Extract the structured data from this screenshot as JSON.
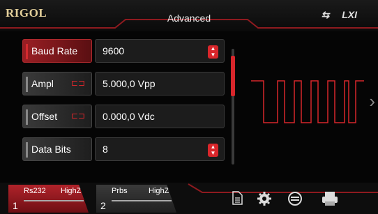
{
  "header": {
    "logo": "RIGOL",
    "title": "Advanced",
    "status_icons": [
      "usb-icon",
      "lxi-icon"
    ],
    "lxi_label": "LXI"
  },
  "params": [
    {
      "label": "Baud Rate",
      "value": "9600",
      "active": true,
      "linked": false,
      "spinner": true
    },
    {
      "label": "Ampl",
      "value": "5.000,0 Vpp",
      "active": false,
      "linked": true,
      "spinner": false
    },
    {
      "label": "Offset",
      "value": "0.000,0 Vdc",
      "active": false,
      "linked": true,
      "spinner": false
    },
    {
      "label": "Data Bits",
      "value": "8",
      "active": false,
      "linked": false,
      "spinner": true
    }
  ],
  "channels": [
    {
      "number": "1",
      "mode": "Rs232",
      "load": "HighZ"
    },
    {
      "number": "2",
      "mode": "Prbs",
      "load": "HighZ"
    }
  ],
  "toolbar_icons": [
    "document-icon",
    "gear-icon",
    "sync-icon",
    "printer-icon"
  ],
  "colors": {
    "accent": "#d7262b",
    "brand": "#e3cf9a"
  }
}
